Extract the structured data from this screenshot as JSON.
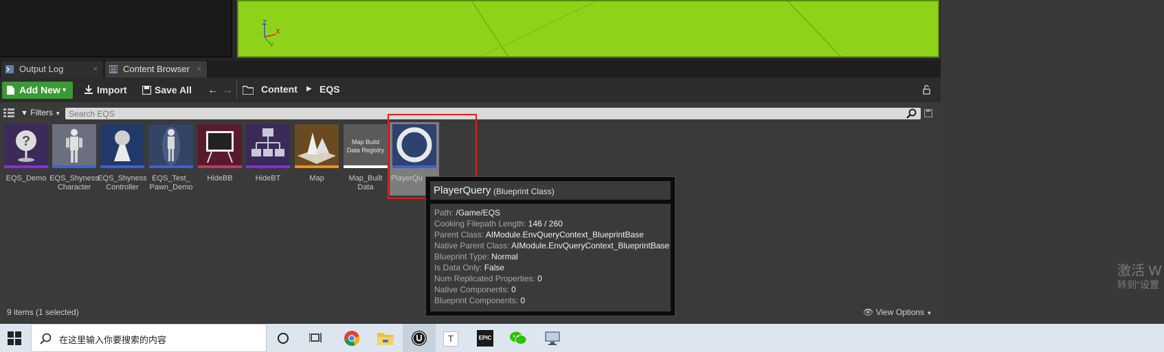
{
  "viewport": {
    "axis_z": "Z",
    "axis_x": "X",
    "axis_y": "Y"
  },
  "tabs": [
    {
      "label": "Output Log",
      "close": "×"
    },
    {
      "label": "Content Browser",
      "close": "×"
    }
  ],
  "toolbar": {
    "add_new": "Add New",
    "import": "Import",
    "save_all": "Save All",
    "breadcrumb": [
      "Content",
      "EQS"
    ]
  },
  "filters": {
    "label": "Filters",
    "search_placeholder": "Search EQS"
  },
  "assets": [
    {
      "name": "EQS_Demo",
      "line2": "",
      "color": "#8a2be2"
    },
    {
      "name": "EQS_Shyness",
      "line2": "Character",
      "color": "#3a62d8"
    },
    {
      "name": "EQS_Shyness",
      "line2": "Controller",
      "color": "#3a62d8"
    },
    {
      "name": "EQS_Test_",
      "line2": "Pawn_Demo",
      "color": "#3a62d8"
    },
    {
      "name": "HideBB",
      "line2": "",
      "color": "#c23a5a"
    },
    {
      "name": "HideBT",
      "line2": "",
      "color": "#8a2be2"
    },
    {
      "name": "Map",
      "line2": "",
      "color": "#f09010"
    },
    {
      "name": "Map_Built",
      "line2": "Data",
      "color": "#ffffff",
      "thumb_text": "Map Build Data Registry"
    },
    {
      "name": "PlayerQu",
      "line2": "",
      "color": "#3a62d8"
    }
  ],
  "tooltip": {
    "title": "PlayerQuery",
    "subtitle": "(Blueprint Class)",
    "rows": [
      {
        "k": "Path:",
        "v": "/Game/EQS"
      },
      {
        "k": "Cooking Filepath Length:",
        "v": "146 / 260"
      },
      {
        "k": "Parent Class:",
        "v": "AIModule.EnvQueryContext_BlueprintBase"
      },
      {
        "k": "Native Parent Class:",
        "v": "AIModule.EnvQueryContext_BlueprintBase"
      },
      {
        "k": "Blueprint Type:",
        "v": "Normal"
      },
      {
        "k": "Is Data Only:",
        "v": "False"
      },
      {
        "k": "Num Replicated Properties:",
        "v": "0"
      },
      {
        "k": "Native Components:",
        "v": "0"
      },
      {
        "k": "Blueprint Components:",
        "v": "0"
      }
    ]
  },
  "status": {
    "count": "9 items (1 selected)",
    "view_options": "View Options"
  },
  "watermark": {
    "line1": "激活 W",
    "line2": "转到\"设置"
  },
  "taskbar": {
    "search_placeholder": "在这里输入你要搜索的内容",
    "epic_label": "EPIC"
  },
  "colors": {
    "add_new_green": "#3a9a35",
    "viewport_green": "#8ed31a",
    "selection_red": "#e02020"
  }
}
